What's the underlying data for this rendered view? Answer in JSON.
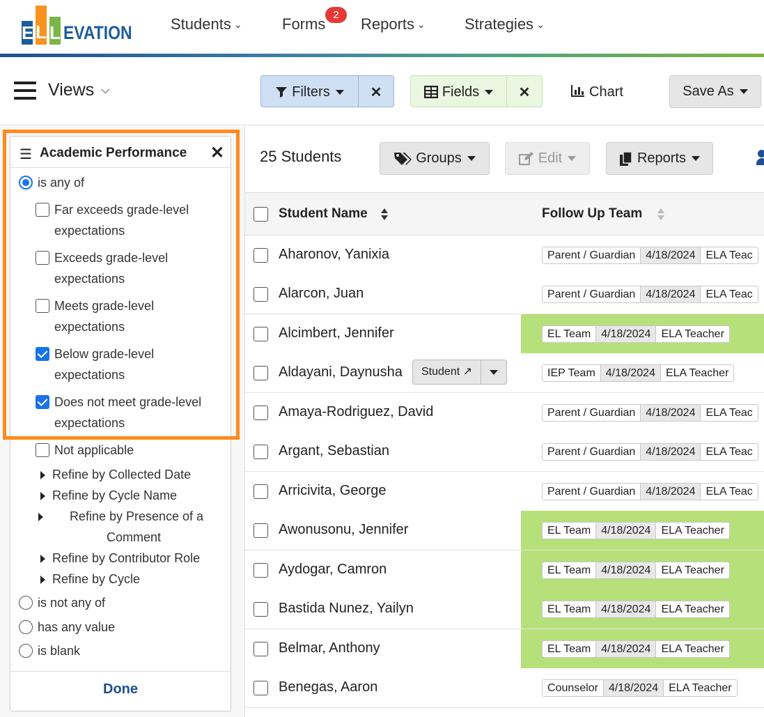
{
  "brand": {
    "logo_letters": [
      "E",
      "L",
      "L"
    ],
    "logo_rest": "EVATION",
    "letter_colors": [
      "#1d5c9a",
      "#f7931e",
      "#7ab648"
    ]
  },
  "nav": {
    "items": [
      {
        "label": "Students",
        "chevron": "chevron-down-icon"
      },
      {
        "label": "Forms",
        "badge": "2"
      },
      {
        "label": "Reports",
        "chevron": "chevron-down-icon"
      },
      {
        "label": "Strategies",
        "chevron": "chevron-down-icon"
      }
    ]
  },
  "toolbar": {
    "views_label": "Views",
    "filters_label": "Filters",
    "fields_label": "Fields",
    "chart_label": "Chart",
    "save_as_label": "Save As",
    "close_glyph": "✕"
  },
  "filter_panel": {
    "title": "Academic Performance",
    "close_glyph": "✕",
    "mode_options": [
      {
        "label": "is any of",
        "selected": true
      },
      {
        "label": "is not any of",
        "selected": false
      },
      {
        "label": "has any value",
        "selected": false
      },
      {
        "label": "is blank",
        "selected": false
      }
    ],
    "checkbox_options": [
      {
        "line1": "Far exceeds grade-level",
        "line2": "expectations",
        "checked": false
      },
      {
        "line1": "Exceeds grade-level",
        "line2": "expectations",
        "checked": false
      },
      {
        "line1": "Meets grade-level",
        "line2": "expectations",
        "checked": false
      },
      {
        "line1": "Below grade-level",
        "line2": "expectations",
        "checked": true
      },
      {
        "line1": "Does not meet grade-level",
        "line2": "expectations",
        "checked": true
      },
      {
        "line1": "Not applicable",
        "line2": "",
        "checked": false
      }
    ],
    "refine": [
      {
        "line1": "Refine by Collected Date"
      },
      {
        "line1": "Refine by Cycle Name"
      },
      {
        "line1": "Refine by Presence of a",
        "line2": "Comment"
      },
      {
        "line1": "Refine by Contributor Role"
      },
      {
        "line1": "Refine by Cycle"
      }
    ],
    "done_label": "Done",
    "highlight_color": "#ff8a1f"
  },
  "results": {
    "count_label": "25 Students",
    "groups_label": "Groups",
    "edit_label": "Edit",
    "reports_label": "Reports"
  },
  "table": {
    "columns": [
      "Student Name",
      "Follow Up Team"
    ],
    "rows": [
      {
        "name": "Aharonov, Yanixia",
        "team": "Parent / Guardian",
        "date": "4/18/2024",
        "role": "ELA Teac",
        "green": false
      },
      {
        "name": "Alarcon, Juan",
        "team": "Parent / Guardian",
        "date": "4/18/2024",
        "role": "ELA Teac",
        "green": false
      },
      {
        "name": "Alcimbert, Jennifer",
        "team": "EL Team",
        "date": "4/18/2024",
        "role": "ELA Teacher",
        "green": true
      },
      {
        "name": "Aldayani, Daynusha",
        "team": "IEP Team",
        "date": "4/18/2024",
        "role": "ELA Teacher",
        "green": false,
        "student_button": "Student ↗"
      },
      {
        "name": "Amaya-Rodriguez, David",
        "team": "Parent / Guardian",
        "date": "4/18/2024",
        "role": "ELA Teac",
        "green": false
      },
      {
        "name": "Argant, Sebastian",
        "team": "Parent / Guardian",
        "date": "4/18/2024",
        "role": "ELA Teac",
        "green": false
      },
      {
        "name": "Arricivita, George",
        "team": "Parent / Guardian",
        "date": "4/18/2024",
        "role": "ELA Teac",
        "green": false
      },
      {
        "name": "Awonusonu, Jennifer",
        "team": "EL Team",
        "date": "4/18/2024",
        "role": "ELA Teacher",
        "green": true
      },
      {
        "name": "Aydogar, Camron",
        "team": "EL Team",
        "date": "4/18/2024",
        "role": "ELA Teacher",
        "green": true
      },
      {
        "name": "Bastida Nunez, Yailyn",
        "team": "EL Team",
        "date": "4/18/2024",
        "role": "ELA Teacher",
        "green": true
      },
      {
        "name": "Belmar, Anthony",
        "team": "EL Team",
        "date": "4/18/2024",
        "role": "ELA Teacher",
        "green": true
      },
      {
        "name": "Benegas, Aaron",
        "team": "Counselor",
        "date": "4/18/2024",
        "role": "ELA Teacher",
        "green": false
      }
    ],
    "highlight_color": "#b5e07a"
  }
}
